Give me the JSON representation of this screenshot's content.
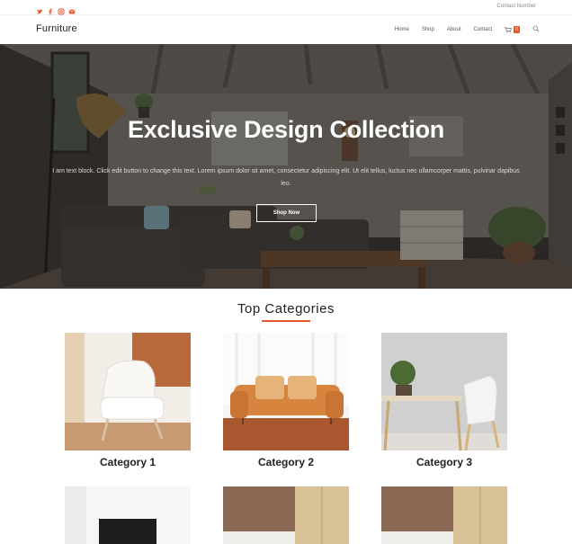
{
  "topbar": {
    "social_icons": [
      "twitter-icon",
      "facebook-icon",
      "instagram-icon",
      "email-icon"
    ],
    "contact_label": "Contact Number"
  },
  "header": {
    "logo": "Furniture",
    "nav": [
      "Home",
      "Shop",
      "About",
      "Contact"
    ],
    "cart_count": "0"
  },
  "hero": {
    "title": "Exclusive Design Collection",
    "text": "I am text block. Click edit button to change this text. Lorem ipsum dolor sit amet, consectetur adipiscing elit. Ut elit tellus, luctus nec ullamcorper mattis, pulvinar dapibus leo.",
    "button": "Shop Now"
  },
  "categories": {
    "title": "Top Categories",
    "items": [
      {
        "label": "Category 1"
      },
      {
        "label": "Category 2"
      },
      {
        "label": "Category 3"
      }
    ]
  },
  "colors": {
    "accent": "#e8562a",
    "text": "#222222"
  }
}
